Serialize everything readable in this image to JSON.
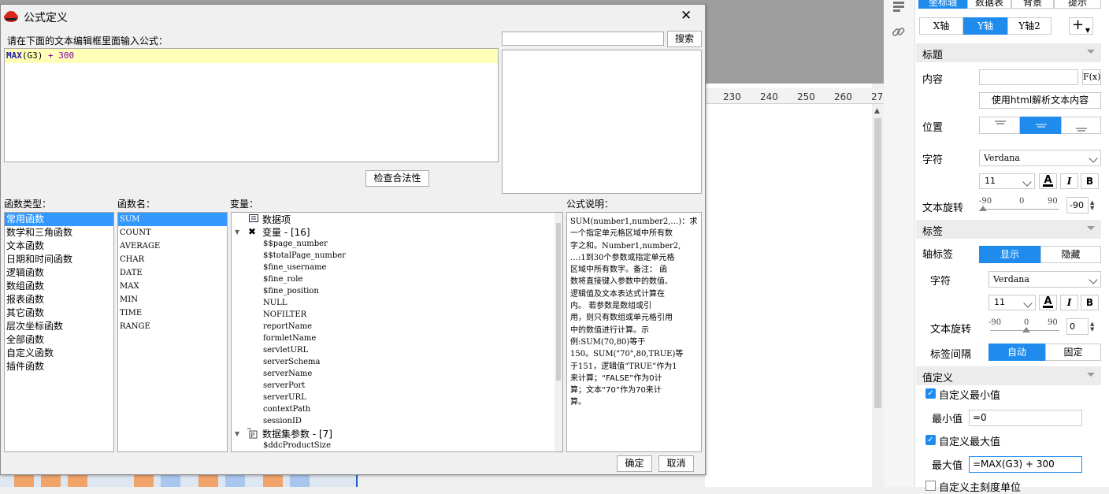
{
  "background": {
    "ruler_ticks": [
      "230",
      "240",
      "250",
      "260",
      "27"
    ]
  },
  "dialog": {
    "title": "公式定义",
    "close_glyph": "✕",
    "prompt_label": "请在下面的文本编辑框里面输入公式：",
    "formula": {
      "fn": "MAX",
      "arg": "(G3)",
      "rest": " + 300"
    },
    "search_button": "搜索",
    "check_button": "检查合法性",
    "func_types_label": "函数类型：",
    "func_names_label": "函数名：",
    "variables_label": "变量：",
    "desc_label": "公式说明：",
    "func_types": [
      "常用函数",
      "数学和三角函数",
      "文本函数",
      "日期和时间函数",
      "逻辑函数",
      "数组函数",
      "报表函数",
      "其它函数",
      "层次坐标函数",
      "全部函数",
      "自定义函数",
      "插件函数"
    ],
    "func_names": [
      "SUM",
      "COUNT",
      "AVERAGE",
      "CHAR",
      "DATE",
      "MAX",
      "MIN",
      "TIME",
      "RANGE"
    ],
    "variables": {
      "data_item": "数据项",
      "vars_group": "变量 - [16]",
      "vars": [
        "$$page_number",
        "$$totalPage_number",
        "$fine_username",
        "$fine_role",
        "$fine_position",
        "NULL",
        "NOFILTER",
        "reportName",
        "formletName",
        "servletURL",
        "serverSchema",
        "serverName",
        "serverPort",
        "serverURL",
        "contextPath",
        "sessionID"
      ],
      "ds_group": "数据集参数 - [7]",
      "ds_params": [
        "$ddcProductSize"
      ]
    },
    "description": [
      "SUM(number1,number2,…)：求",
      "一个指定单元格区域中所有数",
      "字之和。Number1,number2,",
      "…:1到30个参数或指定单元格",
      "区域中所有数字。备注：    函",
      "数将直接键入参数中的数值、",
      "逻辑值及文本表达式计算在",
      "内。    若参数是数组或引",
      "用，则只有数组或单元格引用",
      "中的数值进行计算。示",
      "例:SUM(70,80)等于",
      "150。SUM(\"70\",80,TRUE)等",
      "于151，逻辑值“TRUE”作为1",
      "来计算；“FALSE”作为0计",
      "算；文本“70”作为70来计",
      "算。"
    ],
    "ok_button": "确定",
    "cancel_button": "取消"
  },
  "panel": {
    "top_tabs": [
      "坐标轴",
      "数据表",
      "背景",
      "提示"
    ],
    "axis_tabs": [
      "X轴",
      "Y轴",
      "Y轴2"
    ],
    "add_glyph": "+",
    "title_section": "标题",
    "content_label": "内容",
    "formula_btn": "F(x)",
    "html_button": "使用html解析文本内容",
    "position_label": "位置",
    "char_label": "字符",
    "font_name": "Verdana",
    "font_size": "11",
    "bold": "B",
    "italic": "I",
    "text_rotate_label": "文本旋转",
    "rotate_ticks": [
      "-90",
      "0",
      "90"
    ],
    "rotate_value": "-90",
    "label_section": "标签",
    "axis_label_label": "轴标签",
    "show": "显示",
    "hide": "隐藏",
    "char_label2": "字符",
    "font_name2": "Verdana",
    "font_size2": "11",
    "text_rotate_label2": "文本旋转",
    "rotate_value2": "0",
    "label_interval_label": "标签间隔",
    "auto": "自动",
    "fixed": "固定",
    "value_def_section": "值定义",
    "custom_min": "自定义最小值",
    "min_label": "最小值",
    "min_value": "=0",
    "custom_max": "自定义最大值",
    "max_label": "最大值",
    "max_value": "=MAX(G3) + 300",
    "custom_major": "自定义主刻度单位",
    "accent": "#1f8ced"
  }
}
